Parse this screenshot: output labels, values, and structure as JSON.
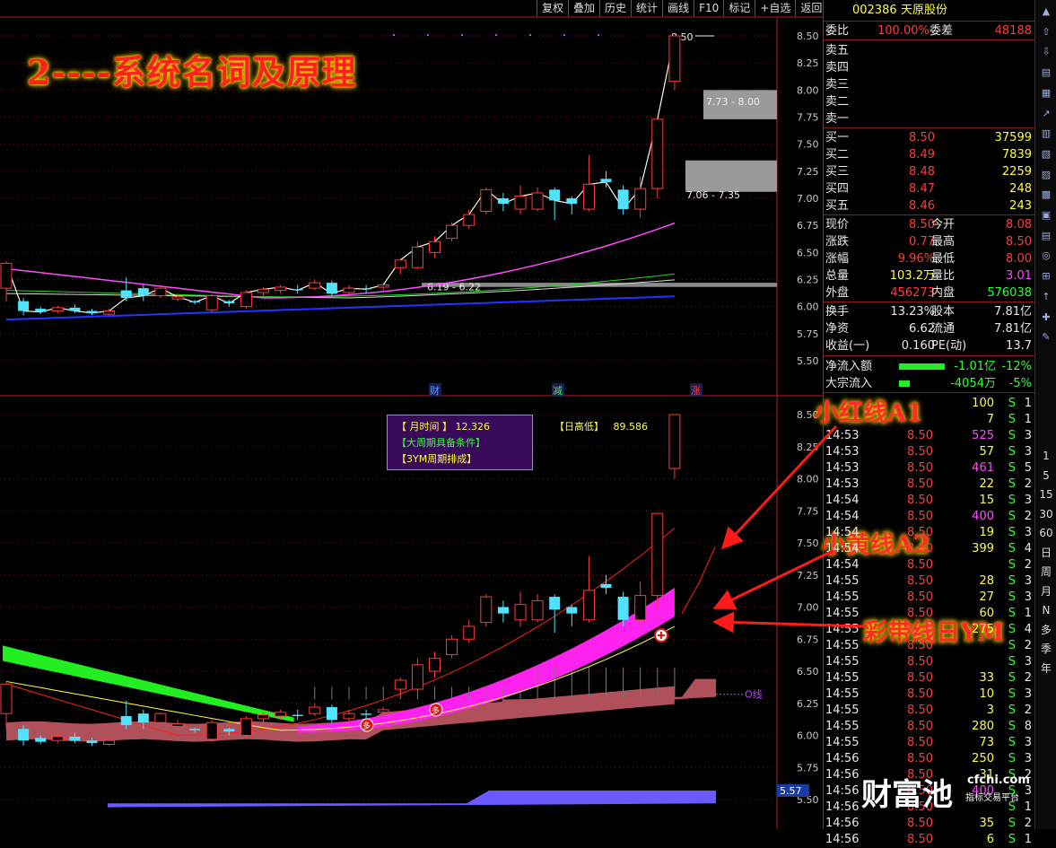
{
  "toolbar": [
    "复权",
    "叠加",
    "历史",
    "统计",
    "画线",
    "F10",
    "标记",
    "+自选",
    "返回"
  ],
  "banner": "2----系统名词及原理",
  "callouts": {
    "a1": "小红线A1",
    "a2": "小黄线A2",
    "ym": "彩带线日YM"
  },
  "upper_chart": {
    "price_labels": [
      "8.50",
      "8.25",
      "8.00",
      "7.75",
      "7.50",
      "7.25",
      "7.00",
      "6.75",
      "6.50",
      "6.25",
      "6.00",
      "5.75",
      "5.50"
    ],
    "high_tag": "8.50",
    "zone1": "7.73 - 8.00",
    "zone2": "7.06 - 7.35",
    "zone3": "6.19 - 6.22",
    "markers": [
      "财",
      "减",
      "涨"
    ]
  },
  "lower_chart": {
    "price_labels": [
      "8.50",
      "8.25",
      "8.00",
      "7.75",
      "7.50",
      "7.25",
      "7.00",
      "6.75",
      "6.50",
      "6.25",
      "6.00",
      "5.75",
      "5.50"
    ],
    "zero_line": "O线",
    "current_tag": "5.57",
    "info": {
      "l1_label": "【 月时间 】",
      "l1_value": "12.326",
      "l1b_label": "【日高低】",
      "l1b_value": "89.586",
      "l2": "【大周期具备条件】",
      "l3": "【3YM周期排成】"
    },
    "badges": [
      "多",
      "多"
    ]
  },
  "quote": {
    "code": "002386",
    "name": "天原股份",
    "weibi_label": "委比",
    "weibi": "100.00%",
    "weicha_label": "委差",
    "weicha": "48188",
    "sell": [
      {
        "l": "卖五"
      },
      {
        "l": "卖四"
      },
      {
        "l": "卖三"
      },
      {
        "l": "卖二"
      },
      {
        "l": "卖一"
      }
    ],
    "buy": [
      {
        "l": "买一",
        "p": "8.50",
        "v": "37599"
      },
      {
        "l": "买二",
        "p": "8.49",
        "v": "7839"
      },
      {
        "l": "买三",
        "p": "8.48",
        "v": "2259"
      },
      {
        "l": "买四",
        "p": "8.47",
        "v": "248"
      },
      {
        "l": "买五",
        "p": "8.46",
        "v": "243"
      }
    ],
    "stats": [
      {
        "a": "现价",
        "av": "8.50",
        "b": "今开",
        "bv": "8.08"
      },
      {
        "a": "涨跌",
        "av": "0.77",
        "b": "最高",
        "bv": "8.50"
      },
      {
        "a": "涨幅",
        "av": "9.96%",
        "b": "最低",
        "bv": "8.00"
      },
      {
        "a": "总量",
        "av": "103.2万",
        "b": "量比",
        "bv": "3.01"
      },
      {
        "a": "外盘",
        "av": "456273",
        "b": "内盘",
        "bv": "576038"
      }
    ],
    "stats2": [
      {
        "a": "换手",
        "av": "13.23%",
        "b": "股本",
        "bv": "7.81亿"
      },
      {
        "a": "净资",
        "av": "6.62",
        "b": "流通",
        "bv": "7.81亿"
      },
      {
        "a": "收益(一)",
        "av": "0.160",
        "b": "PE(动)",
        "bv": "13.7"
      }
    ],
    "flow": [
      {
        "l": "净流入额",
        "v": "-1.01亿",
        "p": "-12%",
        "bar": 0.85
      },
      {
        "l": "大宗流入",
        "v": "-4054万",
        "p": "-5%",
        "bar": 0.2
      }
    ],
    "ticks": [
      {
        "t": "",
        "p": "",
        "v": "100",
        "s": "S",
        "n": "1"
      },
      {
        "t": "",
        "p": "",
        "v": "7",
        "s": "S",
        "n": "1"
      },
      {
        "t": "14:53",
        "p": "8.50",
        "v": "525",
        "s": "S",
        "n": "3"
      },
      {
        "t": "14:53",
        "p": "8.50",
        "v": "57",
        "s": "S",
        "n": "3"
      },
      {
        "t": "14:53",
        "p": "8.50",
        "v": "461",
        "s": "S",
        "n": "5"
      },
      {
        "t": "14:53",
        "p": "8.50",
        "v": "22",
        "s": "S",
        "n": "2"
      },
      {
        "t": "14:54",
        "p": "8.50",
        "v": "15",
        "s": "S",
        "n": "3"
      },
      {
        "t": "14:54",
        "p": "8.50",
        "v": "400",
        "s": "S",
        "n": "2"
      },
      {
        "t": "14:54",
        "p": "8.50",
        "v": "19",
        "s": "S",
        "n": "3"
      },
      {
        "t": "14:54",
        "p": "8.50",
        "v": "399",
        "s": "S",
        "n": "4"
      },
      {
        "t": "14:54",
        "p": "8.50",
        "v": "",
        "s": "S",
        "n": "2"
      },
      {
        "t": "14:55",
        "p": "8.50",
        "v": "28",
        "s": "S",
        "n": "3"
      },
      {
        "t": "14:55",
        "p": "8.50",
        "v": "27",
        "s": "S",
        "n": "3"
      },
      {
        "t": "14:55",
        "p": "8.50",
        "v": "60",
        "s": "S",
        "n": "1"
      },
      {
        "t": "14:55",
        "p": "8.50",
        "v": "275",
        "s": "S",
        "n": "4"
      },
      {
        "t": "14:55",
        "p": "8.50",
        "v": "",
        "s": "S",
        "n": "2"
      },
      {
        "t": "14:55",
        "p": "8.50",
        "v": "",
        "s": "S",
        "n": "3"
      },
      {
        "t": "14:55",
        "p": "8.50",
        "v": "33",
        "s": "S",
        "n": "2"
      },
      {
        "t": "14:55",
        "p": "8.50",
        "v": "10",
        "s": "S",
        "n": "3"
      },
      {
        "t": "14:55",
        "p": "8.50",
        "v": "3",
        "s": "S",
        "n": "2"
      },
      {
        "t": "14:55",
        "p": "8.50",
        "v": "280",
        "s": "S",
        "n": "8"
      },
      {
        "t": "14:55",
        "p": "8.50",
        "v": "73",
        "s": "S",
        "n": "3"
      },
      {
        "t": "14:56",
        "p": "8.50",
        "v": "250",
        "s": "S",
        "n": "3"
      },
      {
        "t": "14:56",
        "p": "8.50",
        "v": "31",
        "s": "S",
        "n": "2"
      },
      {
        "t": "14:56",
        "p": "8.50",
        "v": "400",
        "s": "S",
        "n": "3"
      },
      {
        "t": "14:56",
        "p": "8.50",
        "v": "",
        "s": "S",
        "n": "1"
      },
      {
        "t": "14:56",
        "p": "8.50",
        "v": "35",
        "s": "S",
        "n": "2"
      },
      {
        "t": "14:56",
        "p": "8.50",
        "v": "6",
        "s": "S",
        "n": "1"
      }
    ]
  },
  "iconstrip_text": [
    "1",
    "5",
    "15",
    "30",
    "60",
    "日",
    "周",
    "月",
    "N",
    "多",
    "季",
    "年"
  ],
  "logo": {
    "cn": "财富池",
    "url": "cfchi.com",
    "sub": "指标交易平台"
  },
  "colors": {
    "up": "#ff3b3b",
    "down": "#33ff33",
    "ma_white": "#ffffff",
    "ma_yellow": "#ffff3c",
    "ma_magenta": "#ff4aff",
    "ma_green": "#21d421",
    "ma_blue": "#2233ff"
  }
}
